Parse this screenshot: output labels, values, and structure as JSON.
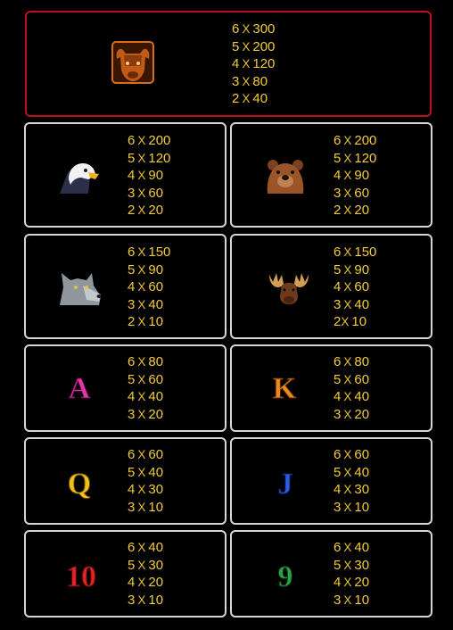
{
  "colors": {
    "background": "#000000",
    "panel_border": "#d6d6d6",
    "top_panel_border": "#c0101c",
    "payout_text": "#f2cc3a"
  },
  "paytable": [
    {
      "symbol": "bison-icon",
      "payouts": [
        {
          "count": "6",
          "sep": "X",
          "value": "300"
        },
        {
          "count": "5",
          "sep": "X",
          "value": "200"
        },
        {
          "count": "4",
          "sep": "X",
          "value": "120"
        },
        {
          "count": "3",
          "sep": "X",
          "value": "80"
        },
        {
          "count": "2",
          "sep": "X",
          "value": "40"
        }
      ]
    },
    {
      "symbol": "eagle-icon",
      "payouts": [
        {
          "count": "6",
          "sep": "X",
          "value": "200"
        },
        {
          "count": "5",
          "sep": "X",
          "value": "120"
        },
        {
          "count": "4",
          "sep": "X",
          "value": "90"
        },
        {
          "count": "3",
          "sep": "X",
          "value": "60"
        },
        {
          "count": "2",
          "sep": "X",
          "value": "20"
        }
      ]
    },
    {
      "symbol": "bear-icon",
      "payouts": [
        {
          "count": "6",
          "sep": "X",
          "value": "200"
        },
        {
          "count": "5",
          "sep": "X",
          "value": "120"
        },
        {
          "count": "4",
          "sep": "X",
          "value": "90"
        },
        {
          "count": "3",
          "sep": "X",
          "value": "60"
        },
        {
          "count": "2",
          "sep": "X",
          "value": "20"
        }
      ]
    },
    {
      "symbol": "wolf-icon",
      "payouts": [
        {
          "count": "6",
          "sep": "X",
          "value": "150"
        },
        {
          "count": "5",
          "sep": "X",
          "value": "90"
        },
        {
          "count": "4",
          "sep": "X",
          "value": "60"
        },
        {
          "count": "3",
          "sep": "X",
          "value": "40"
        },
        {
          "count": "2",
          "sep": "X",
          "value": "10"
        }
      ]
    },
    {
      "symbol": "moose-icon",
      "payouts": [
        {
          "count": "6",
          "sep": "X",
          "value": "150"
        },
        {
          "count": "5",
          "sep": "X",
          "value": "90"
        },
        {
          "count": "4",
          "sep": "X",
          "value": "60"
        },
        {
          "count": "3",
          "sep": "X",
          "value": "40"
        },
        {
          "count": "2",
          "sep": "X",
          "value": "10"
        }
      ]
    },
    {
      "symbol": "letter-a-icon",
      "payouts": [
        {
          "count": "6",
          "sep": "X",
          "value": "80"
        },
        {
          "count": "5",
          "sep": "X",
          "value": "60"
        },
        {
          "count": "4",
          "sep": "X",
          "value": "40"
        },
        {
          "count": "3",
          "sep": "X",
          "value": "20"
        }
      ]
    },
    {
      "symbol": "letter-k-icon",
      "payouts": [
        {
          "count": "6",
          "sep": "X",
          "value": "80"
        },
        {
          "count": "5",
          "sep": "X",
          "value": "60"
        },
        {
          "count": "4",
          "sep": "X",
          "value": "40"
        },
        {
          "count": "3",
          "sep": "X",
          "value": "20"
        }
      ]
    },
    {
      "symbol": "letter-q-icon",
      "payouts": [
        {
          "count": "6",
          "sep": "X",
          "value": "60"
        },
        {
          "count": "5",
          "sep": "X",
          "value": "40"
        },
        {
          "count": "4",
          "sep": "X",
          "value": "30"
        },
        {
          "count": "3",
          "sep": "X",
          "value": "10"
        }
      ]
    },
    {
      "symbol": "letter-j-icon",
      "payouts": [
        {
          "count": "6",
          "sep": "X",
          "value": "60"
        },
        {
          "count": "5",
          "sep": "X",
          "value": "40"
        },
        {
          "count": "4",
          "sep": "X",
          "value": "30"
        },
        {
          "count": "3",
          "sep": "X",
          "value": "10"
        }
      ]
    },
    {
      "symbol": "number-10-icon",
      "payouts": [
        {
          "count": "6",
          "sep": "X",
          "value": "40"
        },
        {
          "count": "5",
          "sep": "X",
          "value": "30"
        },
        {
          "count": "4",
          "sep": "X",
          "value": "20"
        },
        {
          "count": "3",
          "sep": "X",
          "value": "10"
        }
      ]
    },
    {
      "symbol": "number-9-icon",
      "payouts": [
        {
          "count": "6",
          "sep": "X",
          "value": "40"
        },
        {
          "count": "5",
          "sep": "X",
          "value": "30"
        },
        {
          "count": "4",
          "sep": "X",
          "value": "20"
        },
        {
          "count": "3",
          "sep": "X",
          "value": "10"
        }
      ]
    }
  ]
}
